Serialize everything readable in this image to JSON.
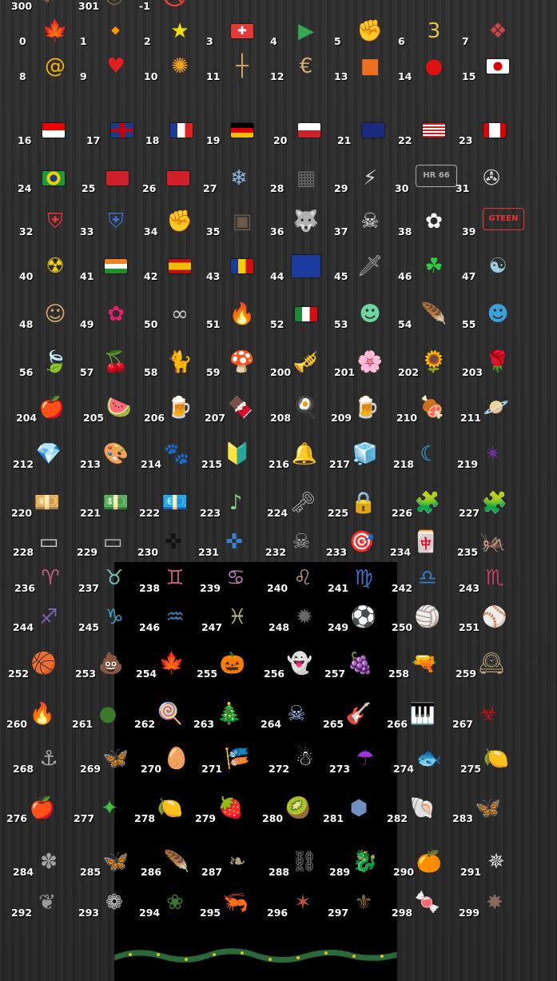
{
  "icons": [
    {
      "id": "0",
      "name": "maple-leaf-icon",
      "glyph": "🍁",
      "color": "#c62828"
    },
    {
      "id": "1",
      "name": "fire-leaf-icon",
      "glyph": "🔸",
      "color": "#e07a2a"
    },
    {
      "id": "2",
      "name": "star-icon",
      "glyph": "★",
      "color": "#f4e000"
    },
    {
      "id": "3",
      "name": "swiss-flag-icon",
      "glyph": "✚",
      "color": "#e53935",
      "flag": "swiss"
    },
    {
      "id": "4",
      "name": "play-store-icon",
      "glyph": "▶",
      "color": "#34a853"
    },
    {
      "id": "5",
      "name": "fist-icon",
      "glyph": "✊",
      "color": "#3aa0d8"
    },
    {
      "id": "6",
      "name": "number-3-icon",
      "glyph": "3",
      "color": "#e6c04a"
    },
    {
      "id": "7",
      "name": "emblem-icon",
      "glyph": "❖",
      "color": "#c44"
    },
    {
      "id": "8",
      "name": "spiral-icon",
      "glyph": "@",
      "color": "#f2b40c"
    },
    {
      "id": "9",
      "name": "heart-icon",
      "glyph": "♥",
      "color": "#e02020"
    },
    {
      "id": "10",
      "name": "sunburst-icon",
      "glyph": "✺",
      "color": "#f4a020"
    },
    {
      "id": "11",
      "name": "cross-icon",
      "glyph": "┼",
      "color": "#caa060"
    },
    {
      "id": "12",
      "name": "c-logo-icon",
      "glyph": "€",
      "color": "#d4b070"
    },
    {
      "id": "13",
      "name": "orange-block-icon",
      "glyph": "■",
      "color": "#f07020"
    },
    {
      "id": "14",
      "name": "red-dot-icon",
      "glyph": "●",
      "color": "#e01010"
    },
    {
      "id": "15",
      "name": "japan-flag-icon",
      "glyph": "",
      "color": "#fff",
      "flag": "japan"
    },
    {
      "id": "16",
      "name": "singapore-flag-icon",
      "glyph": "",
      "color": "#fff",
      "flag": "singapore"
    },
    {
      "id": "17",
      "name": "uk-flag-icon",
      "glyph": "",
      "color": "#fff",
      "flag": "uk"
    },
    {
      "id": "18",
      "name": "france-flag-icon",
      "glyph": "",
      "color": "#fff",
      "flag": "france"
    },
    {
      "id": "19",
      "name": "germany-flag-icon",
      "glyph": "",
      "color": "#fff",
      "flag": "germany"
    },
    {
      "id": "20",
      "name": "poland-flag-icon",
      "glyph": "",
      "color": "#fff",
      "flag": "poland"
    },
    {
      "id": "21",
      "name": "australia-flag-icon",
      "glyph": "",
      "color": "#fff",
      "flag": "australia"
    },
    {
      "id": "22",
      "name": "usa-flag-icon",
      "glyph": "",
      "color": "#fff",
      "flag": "usa"
    },
    {
      "id": "23",
      "name": "canada-flag-icon",
      "glyph": "",
      "color": "#fff",
      "flag": "canada"
    },
    {
      "id": "24",
      "name": "brazil-flag-icon",
      "glyph": "",
      "color": "#fff",
      "flag": "brazil"
    },
    {
      "id": "25",
      "name": "hong-kong-flag-icon",
      "glyph": "",
      "color": "#fff",
      "flag": "hongkong"
    },
    {
      "id": "26",
      "name": "turkey-flag-icon",
      "glyph": "",
      "color": "#fff",
      "flag": "turkey"
    },
    {
      "id": "27",
      "name": "snowflake-icon",
      "glyph": "❄",
      "color": "#8fb8e0"
    },
    {
      "id": "28",
      "name": "grille-icon",
      "glyph": "▦",
      "color": "#666"
    },
    {
      "id": "29",
      "name": "lightning-icon",
      "glyph": "⚡",
      "color": "#ccc"
    },
    {
      "id": "30",
      "name": "license-plate-icon",
      "glyph": "",
      "color": "#aaa",
      "text": "HR 66"
    },
    {
      "id": "31",
      "name": "mercedes-logo-icon",
      "glyph": "✇",
      "color": "#ccc"
    },
    {
      "id": "32",
      "name": "england-shield-icon",
      "glyph": "⛨",
      "color": "#e33"
    },
    {
      "id": "33",
      "name": "finland-shield-icon",
      "glyph": "⛨",
      "color": "#3a6fc4"
    },
    {
      "id": "34",
      "name": "fist-bump-icon",
      "glyph": "✊",
      "color": "#d6a46a"
    },
    {
      "id": "35",
      "name": "chest-icon",
      "glyph": "▣",
      "color": "#6a5a4a"
    },
    {
      "id": "36",
      "name": "wolf-icon",
      "glyph": "🐺",
      "color": "#aaa"
    },
    {
      "id": "37",
      "name": "skull-crossbones-icon",
      "glyph": "☠",
      "color": "#eee"
    },
    {
      "id": "38",
      "name": "daisy-icon",
      "glyph": "✿",
      "color": "#fff"
    },
    {
      "id": "39",
      "name": "gamepad-icon",
      "glyph": "",
      "color": "#e33",
      "text": "GTEEN"
    },
    {
      "id": "40",
      "name": "radiation-icon",
      "glyph": "☢",
      "color": "#f2d010"
    },
    {
      "id": "41",
      "name": "india-flag-icon",
      "glyph": "",
      "color": "#fff",
      "flag": "india"
    },
    {
      "id": "42",
      "name": "spain-flag-icon",
      "glyph": "",
      "color": "#fff",
      "flag": "spain"
    },
    {
      "id": "43",
      "name": "romania-flag-icon",
      "glyph": "",
      "color": "#fff",
      "flag": "romania"
    },
    {
      "id": "44",
      "name": "eu-flag-icon",
      "glyph": "",
      "color": "#fff",
      "flag": "eu"
    },
    {
      "id": "45",
      "name": "sword-icon",
      "glyph": "🗡",
      "color": "#aaa"
    },
    {
      "id": "46",
      "name": "clover-icon",
      "glyph": "☘",
      "color": "#2ecc40"
    },
    {
      "id": "47",
      "name": "yin-yang-icon",
      "glyph": "☯",
      "color": "#9cd"
    },
    {
      "id": "48",
      "name": "face-icon",
      "glyph": "☺",
      "color": "#d6a46a"
    },
    {
      "id": "49",
      "name": "hibiscus-icon",
      "glyph": "✿",
      "color": "#e0206a"
    },
    {
      "id": "50",
      "name": "handcuffs-icon",
      "glyph": "∞",
      "color": "#ccc"
    },
    {
      "id": "51",
      "name": "flame-logo-icon",
      "glyph": "🔥",
      "color": "#f06020"
    },
    {
      "id": "52",
      "name": "mexico-flag-icon",
      "glyph": "",
      "color": "#fff",
      "flag": "mexico"
    },
    {
      "id": "53",
      "name": "monster-icon",
      "glyph": "☻",
      "color": "#6fd6a0"
    },
    {
      "id": "54",
      "name": "purple-feather-icon",
      "glyph": "🪶",
      "color": "#7030c0"
    },
    {
      "id": "55",
      "name": "blue-alien-icon",
      "glyph": "☻",
      "color": "#3aa0d8"
    },
    {
      "id": "56",
      "name": "leaf-icon",
      "glyph": "🍃",
      "color": "#2e8b2e"
    },
    {
      "id": "57",
      "name": "cherry-icon",
      "glyph": "🍒",
      "color": "#e0206a"
    },
    {
      "id": "58",
      "name": "black-animal-icon",
      "glyph": "🐈",
      "color": "#222"
    },
    {
      "id": "59",
      "name": "mushroom-icon",
      "glyph": "🍄",
      "color": "#e03030"
    },
    {
      "id": "200",
      "name": "party-horn-icon",
      "glyph": "🎺",
      "color": "#e8d030"
    },
    {
      "id": "201",
      "name": "cherry-blossom-icon",
      "glyph": "🌸",
      "color": "#f0a0d0"
    },
    {
      "id": "202",
      "name": "sunflower-icon",
      "glyph": "🌻",
      "color": "#f4c010"
    },
    {
      "id": "203",
      "name": "rose-icon",
      "glyph": "🌹",
      "color": "#d01010"
    },
    {
      "id": "204",
      "name": "apple-icon",
      "glyph": "🍎",
      "color": "#e02020"
    },
    {
      "id": "205",
      "name": "watermelon-icon",
      "glyph": "🍉",
      "color": "#e04040"
    },
    {
      "id": "206",
      "name": "beer-mug-icon",
      "glyph": "🍺",
      "color": "#e0a040"
    },
    {
      "id": "207",
      "name": "chocolate-icon",
      "glyph": "🍫",
      "color": "#8a3a1a"
    },
    {
      "id": "208",
      "name": "fried-egg-icon",
      "glyph": "🍳",
      "color": "#fff"
    },
    {
      "id": "209",
      "name": "beer-glass-icon",
      "glyph": "🍺",
      "color": "#f0a020"
    },
    {
      "id": "210",
      "name": "meat-icon",
      "glyph": "🍖",
      "color": "#c06030"
    },
    {
      "id": "211",
      "name": "planet-icon",
      "glyph": "🪐",
      "color": "#c090e0"
    },
    {
      "id": "212",
      "name": "diamond-icon",
      "glyph": "💎",
      "color": "#3aa0e8"
    },
    {
      "id": "213",
      "name": "palette-icon",
      "glyph": "🎨",
      "color": "#d6a46a"
    },
    {
      "id": "214",
      "name": "paw-icon",
      "glyph": "🐾",
      "color": "#f0a0b0"
    },
    {
      "id": "215",
      "name": "beginner-icon",
      "glyph": "🔰",
      "color": "#2eaa40"
    },
    {
      "id": "216",
      "name": "bell-icon",
      "glyph": "🔔",
      "color": "#d0a030"
    },
    {
      "id": "217",
      "name": "orange-cube-icon",
      "glyph": "🧊",
      "color": "#f07020"
    },
    {
      "id": "218",
      "name": "crescent-icon",
      "glyph": "☾",
      "color": "#3ab0f0"
    },
    {
      "id": "219",
      "name": "purple-star-icon",
      "glyph": "✴",
      "color": "#7030a0"
    },
    {
      "id": "220",
      "name": "yen-note-icon",
      "glyph": "💴",
      "color": "#c0b080"
    },
    {
      "id": "221",
      "name": "dollar-note-icon",
      "glyph": "💵",
      "color": "#8a9a70"
    },
    {
      "id": "222",
      "name": "euro-note-icon",
      "glyph": "💶",
      "color": "#5aa060"
    },
    {
      "id": "223",
      "name": "green-pipe-icon",
      "glyph": "♪",
      "color": "#8ad08a"
    },
    {
      "id": "224",
      "name": "key-icon",
      "glyph": "🗝",
      "color": "#aaa"
    },
    {
      "id": "225",
      "name": "padlock-icon",
      "glyph": "🔒",
      "color": "#aaa"
    },
    {
      "id": "226",
      "name": "green-puzzle-icon",
      "glyph": "🧩",
      "color": "#6ac080"
    },
    {
      "id": "227",
      "name": "pink-puzzle-icon",
      "glyph": "🧩",
      "color": "#d0a0d8"
    },
    {
      "id": "228",
      "name": "stone-plaque-icon",
      "glyph": "▭",
      "color": "#ccc"
    },
    {
      "id": "229",
      "name": "stone-tablet-icon",
      "glyph": "▭",
      "color": "#bbb"
    },
    {
      "id": "230",
      "name": "black-cross-icon",
      "glyph": "✜",
      "color": "#111"
    },
    {
      "id": "231",
      "name": "blue-cross-icon",
      "glyph": "✜",
      "color": "#3a80d0"
    },
    {
      "id": "232",
      "name": "skull-ornament-icon",
      "glyph": "☠",
      "color": "#aaa"
    },
    {
      "id": "233",
      "name": "dartboard-icon",
      "glyph": "🎯",
      "color": "#c03030"
    },
    {
      "id": "234",
      "name": "mahjong-icon",
      "glyph": "🀄",
      "color": "#e0e0d0"
    },
    {
      "id": "235",
      "name": "grasshopper-icon",
      "glyph": "🦗",
      "color": "#7ab040"
    },
    {
      "id": "236",
      "name": "aries-icon",
      "glyph": "♈",
      "color": "#c06080"
    },
    {
      "id": "237",
      "name": "taurus-icon",
      "glyph": "♉",
      "color": "#70c0b0"
    },
    {
      "id": "238",
      "name": "gemini-icon",
      "glyph": "♊",
      "color": "#c06070"
    },
    {
      "id": "239",
      "name": "cancer-icon",
      "glyph": "♋",
      "color": "#c080c0"
    },
    {
      "id": "240",
      "name": "leo-icon",
      "glyph": "♌",
      "color": "#c0a080"
    },
    {
      "id": "241",
      "name": "virgo-icon",
      "glyph": "♍",
      "color": "#4070c0"
    },
    {
      "id": "242",
      "name": "libra-icon",
      "glyph": "♎",
      "color": "#3080c0"
    },
    {
      "id": "243",
      "name": "scorpio-icon",
      "glyph": "♏",
      "color": "#c04060"
    },
    {
      "id": "244",
      "name": "sagittarius-icon",
      "glyph": "♐",
      "color": "#8060b0"
    },
    {
      "id": "245",
      "name": "capricorn-icon",
      "glyph": "♑",
      "color": "#40a0c0"
    },
    {
      "id": "246",
      "name": "aquarius-icon",
      "glyph": "♒",
      "color": "#4080c0"
    },
    {
      "id": "247",
      "name": "pisces-icon",
      "glyph": "♓",
      "color": "#b0b070"
    },
    {
      "id": "248",
      "name": "spiked-ball-icon",
      "glyph": "✹",
      "color": "#666"
    },
    {
      "id": "249",
      "name": "soccer-ball-icon",
      "glyph": "⚽",
      "color": "#fff"
    },
    {
      "id": "250",
      "name": "volleyball-icon",
      "glyph": "🏐",
      "color": "#ddd"
    },
    {
      "id": "251",
      "name": "baseball-icon",
      "glyph": "⚾",
      "color": "#eee"
    },
    {
      "id": "252",
      "name": "basketball-icon",
      "glyph": "🏀",
      "color": "#e07020"
    },
    {
      "id": "253",
      "name": "poop-icon",
      "glyph": "💩",
      "color": "#8a5030"
    },
    {
      "id": "254",
      "name": "maple-leaf-red-icon",
      "glyph": "🍁",
      "color": "#e04020"
    },
    {
      "id": "255",
      "name": "pumpkin-icon",
      "glyph": "🎃",
      "color": "#f07010"
    },
    {
      "id": "256",
      "name": "ghost-icon",
      "glyph": "👻",
      "color": "#eee"
    },
    {
      "id": "257",
      "name": "grapes-icon",
      "glyph": "🍇",
      "color": "#7040a0"
    },
    {
      "id": "258",
      "name": "revolver-icon",
      "glyph": "🔫",
      "color": "#888"
    },
    {
      "id": "259",
      "name": "clock-icon",
      "glyph": "🕰",
      "color": "#c0a880"
    },
    {
      "id": "260",
      "name": "blue-flame-icon",
      "glyph": "🔥",
      "color": "#3080f0"
    },
    {
      "id": "261",
      "name": "moss-ball-icon",
      "glyph": "●",
      "color": "#3a7a2a"
    },
    {
      "id": "262",
      "name": "lollipop-icon",
      "glyph": "🍭",
      "color": "#f0e060"
    },
    {
      "id": "263",
      "name": "christmas-tree-icon",
      "glyph": "🎄",
      "color": "#2a8a3a"
    },
    {
      "id": "264",
      "name": "ice-skull-icon",
      "glyph": "☠",
      "color": "#a0c8f0"
    },
    {
      "id": "265",
      "name": "guitar-icon",
      "glyph": "🎸",
      "color": "#c03030"
    },
    {
      "id": "266",
      "name": "keyboard-icon",
      "glyph": "🎹",
      "color": "#333"
    },
    {
      "id": "267",
      "name": "biohazard-icon",
      "glyph": "☣",
      "color": "#c01010"
    },
    {
      "id": "268",
      "name": "anchor-icon",
      "glyph": "⚓",
      "color": "#aaa"
    },
    {
      "id": "269",
      "name": "butterfly-icon",
      "glyph": "🦋",
      "color": "#20c0c0"
    },
    {
      "id": "270",
      "name": "easter-egg-icon",
      "glyph": "🥚",
      "color": "#f0a0b0"
    },
    {
      "id": "271",
      "name": "koinobori-icon",
      "glyph": "🎏",
      "color": "#3080e0"
    },
    {
      "id": "272",
      "name": "teru-teru-icon",
      "glyph": "☃",
      "color": "#eee"
    },
    {
      "id": "273",
      "name": "umbrella-icon",
      "glyph": "☂",
      "color": "#a030e0"
    },
    {
      "id": "274",
      "name": "blue-fish-icon",
      "glyph": "🐟",
      "color": "#40a0f0"
    },
    {
      "id": "275",
      "name": "lemon-icon",
      "glyph": "🍋",
      "color": "#d0d040"
    },
    {
      "id": "276",
      "name": "bitten-apple-icon",
      "glyph": "🍎",
      "color": "#e02030"
    },
    {
      "id": "277",
      "name": "dragonfly-icon",
      "glyph": "✦",
      "color": "#40c040"
    },
    {
      "id": "278",
      "name": "lime-icon",
      "glyph": "🍋",
      "color": "#c0e040"
    },
    {
      "id": "279",
      "name": "strawberry-icon",
      "glyph": "🍓",
      "color": "#e02030"
    },
    {
      "id": "280",
      "name": "kiwi-icon",
      "glyph": "🥝",
      "color": "#60b020"
    },
    {
      "id": "281",
      "name": "blue-rock-icon",
      "glyph": "⬢",
      "color": "#7090c0"
    },
    {
      "id": "282",
      "name": "seashell-icon",
      "glyph": "🐚",
      "color": "#e0b090"
    },
    {
      "id": "283",
      "name": "moth-icon",
      "glyph": "🦋",
      "color": "#c08030"
    },
    {
      "id": "284",
      "name": "feathered-mask-icon",
      "glyph": "✽",
      "color": "#a0a0a0"
    },
    {
      "id": "285",
      "name": "purple-moth-icon",
      "glyph": "🦋",
      "color": "#b090d0"
    },
    {
      "id": "286",
      "name": "feather-quill-icon",
      "glyph": "🪶",
      "color": "#6040c0"
    },
    {
      "id": "287",
      "name": "flourish-icon",
      "glyph": "❧",
      "color": "#b0a080"
    },
    {
      "id": "288",
      "name": "chain-icon",
      "glyph": "⛓",
      "color": "#888"
    },
    {
      "id": "289",
      "name": "dragon-icon",
      "glyph": "🐉",
      "color": "#888"
    },
    {
      "id": "290",
      "name": "orange-slice-icon",
      "glyph": "🍊",
      "color": "#f0a020"
    },
    {
      "id": "291",
      "name": "compass-star-icon",
      "glyph": "✵",
      "color": "#ddd"
    },
    {
      "id": "292",
      "name": "wings-icon",
      "glyph": "❦",
      "color": "#999"
    },
    {
      "id": "293",
      "name": "lotus-icon",
      "glyph": "❁",
      "color": "#ccc"
    },
    {
      "id": "294",
      "name": "wreath-icon",
      "glyph": "❀",
      "color": "#3a7a2a"
    },
    {
      "id": "295",
      "name": "shrimp-icon",
      "glyph": "🦐",
      "color": "#f07080"
    },
    {
      "id": "296",
      "name": "starfish-icon",
      "glyph": "✶",
      "color": "#c05040"
    },
    {
      "id": "297",
      "name": "bronze-medallion-icon",
      "glyph": "⚜",
      "color": "#8a6a3a"
    },
    {
      "id": "298",
      "name": "candy-icon",
      "glyph": "🍬",
      "color": "#40b060"
    },
    {
      "id": "299",
      "name": "tribal-icon",
      "glyph": "✸",
      "color": "#8a6a5a"
    },
    {
      "id": "300",
      "name": "purple-bat-icon",
      "glyph": "🦇",
      "color": "#5040b0"
    },
    {
      "id": "301",
      "name": "coin-icon",
      "glyph": "◎",
      "color": "#7a6a3a"
    },
    {
      "id": "-1",
      "name": "prohibited-icon",
      "glyph": "🚫",
      "color": "#d01010"
    }
  ],
  "bottom_strip": {
    "name": "snake-border"
  }
}
